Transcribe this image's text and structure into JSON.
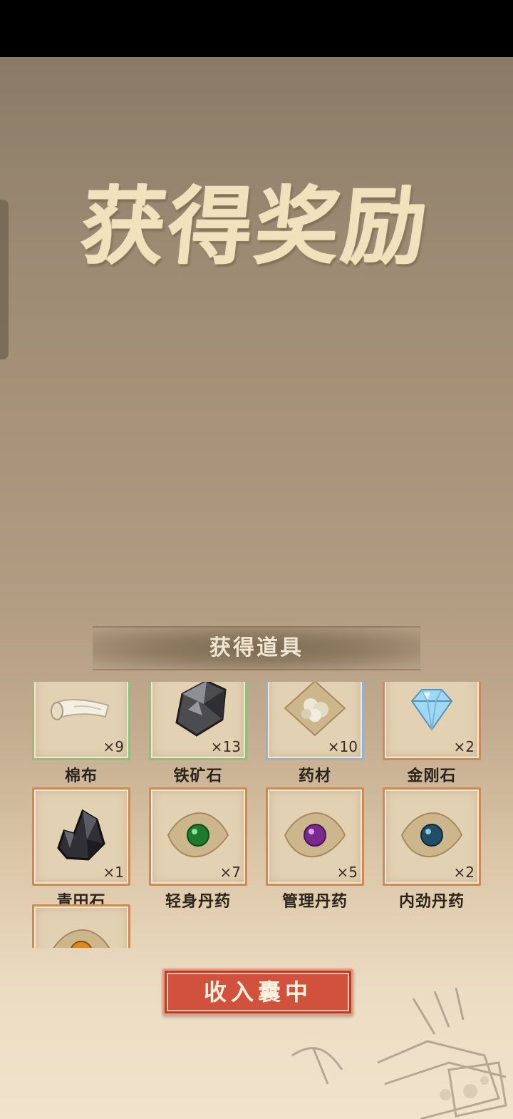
{
  "title": "获得奖励",
  "section_title": "获得道具",
  "items": [
    {
      "name": "棉布",
      "qty": "×9",
      "icon": "cloth-scroll-icon",
      "frame": "green"
    },
    {
      "name": "铁矿石",
      "qty": "×13",
      "icon": "iron-ore-icon",
      "frame": "green"
    },
    {
      "name": "药材",
      "qty": "×10",
      "icon": "herbs-icon",
      "frame": "blue"
    },
    {
      "name": "金刚石",
      "qty": "×2",
      "icon": "diamond-icon",
      "frame": "orange"
    },
    {
      "name": "青田石",
      "qty": "×1",
      "icon": "dark-stone-icon",
      "frame": "orange"
    },
    {
      "name": "轻身丹药",
      "qty": "×7",
      "icon": "green-pill-icon",
      "frame": "orange"
    },
    {
      "name": "管理丹药",
      "qty": "×5",
      "icon": "purple-pill-icon",
      "frame": "orange"
    },
    {
      "name": "内劲丹药",
      "qty": "×2",
      "icon": "blue-pill-icon",
      "frame": "orange"
    },
    {
      "name": "",
      "qty": "",
      "icon": "orange-pill-icon",
      "frame": "orange"
    }
  ],
  "collect_button": "收入囊中",
  "colors": {
    "accent": "#d2513d",
    "title": "#f1e2bd",
    "frame_green": "#8fbf7a",
    "frame_blue": "#8fb2d6",
    "frame_orange": "#c98b5a"
  }
}
